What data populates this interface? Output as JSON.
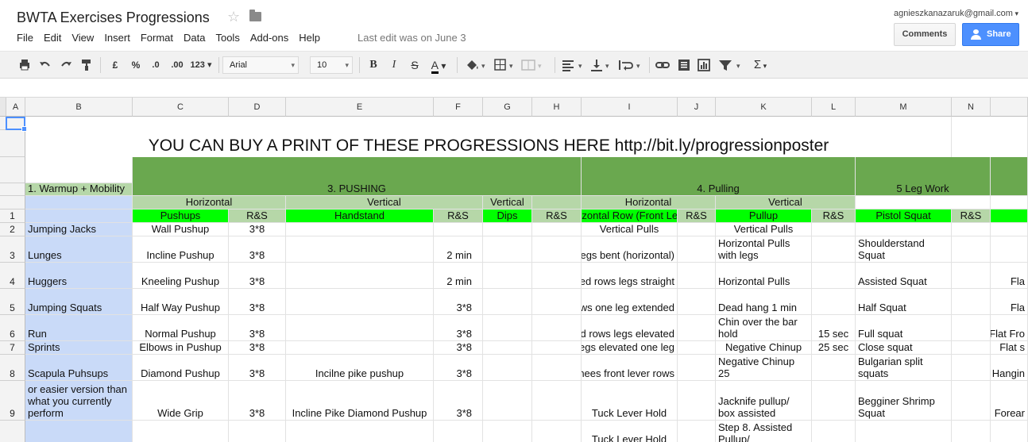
{
  "app": {
    "title": "BWTA Exercises Progressions",
    "account": "agnieszkanazaruk@gmail.com",
    "comments_label": "Comments",
    "share_label": "Share",
    "last_edit": "Last edit was on June 3",
    "menu": [
      "File",
      "Edit",
      "View",
      "Insert",
      "Format",
      "Data",
      "Tools",
      "Add-ons",
      "Help"
    ]
  },
  "toolbar": {
    "currency": "£",
    "percent": "%",
    "dec_less": ".0",
    "dec_more": ".00",
    "format_more": "123",
    "font": "Arial",
    "font_size": "10",
    "bold": "B",
    "italic": "I",
    "strike": "S",
    "text_color": "A",
    "sigma": "Σ"
  },
  "columns": [
    "A",
    "B",
    "C",
    "D",
    "E",
    "F",
    "G",
    "H",
    "I",
    "J",
    "K",
    "L",
    "M",
    "N"
  ],
  "banner": "YOU CAN BUY A PRINT OF THESE PROGRESSIONS HERE http://bit.ly/progressionposter",
  "groups": {
    "pushing": "3. PUSHING",
    "pulling": "4. Pulling",
    "legs": "5 Leg Work"
  },
  "subheaders": {
    "warmup": "1. Warmup + Mobility",
    "push_horizontal": "Horizontal",
    "push_vertical": "Vertical",
    "push_vertical2": "Vertical",
    "pull_horizontal": "Horizontal",
    "pull_vertical": "Vertical"
  },
  "header_row": {
    "num": "1",
    "c": "Pushups",
    "d": "R&S",
    "e": "Handstand",
    "f": "R&S",
    "g": "Dips",
    "h": "R&S",
    "i": "Horizontal Row (Front Lever)",
    "j": "R&S",
    "k": "Pullup",
    "l": "R&S",
    "m": "Pistol Squat",
    "n": "R&S"
  },
  "rows": [
    {
      "num": "2",
      "b": "Jumping Jacks",
      "c": "Wall Pushup",
      "d": "3*8",
      "e": "",
      "f": "",
      "i": "Vertical Pulls",
      "k": "Vertical Pulls",
      "l": "",
      "m": "",
      "o": ""
    },
    {
      "num": "3",
      "b": "Lunges",
      "c": "Incline Pushup",
      "d": "3*8",
      "e": "",
      "f": "2 min",
      "i": "Rows legs bent  (horizontal)",
      "k": "Horizontal Pulls with legs",
      "l": "",
      "m": "Shoulderstand Squat",
      "o": ""
    },
    {
      "num": "4",
      "b": "Huggers",
      "c": "Kneeling Pushup",
      "d": "3*8",
      "e": "",
      "f": "2 min",
      "i": "Inverted rows legs straight",
      "k": "Horizontal Pulls",
      "l": "",
      "m": "Assisted Squat",
      "o": "Fla"
    },
    {
      "num": "5",
      "b": "Jumping Squats",
      "c": "Half Way Pushup",
      "d": "3*8",
      "e": "",
      "f": "3*8",
      "i": "Inverted rows one leg extended",
      "k": "Dead hang 1 min",
      "l": "",
      "m": "Half Squat",
      "o": "Fla"
    },
    {
      "num": "6",
      "b": "Run",
      "c": "Normal Pushup",
      "d": "3*8",
      "e": "",
      "f": "3*8",
      "i": "Inverted rows legs elevated",
      "k": "Chin over the bar hold",
      "l": "15 sec",
      "m": "Full squat",
      "o": "Flat Fro"
    },
    {
      "num": "7",
      "b": "Sprints",
      "c": "Elbows in Pushup",
      "d": "3*8",
      "e": "",
      "f": "3*8",
      "i": "Rows legs elevated one leg",
      "k": "Negative Chinup",
      "l": "25 sec",
      "m": "Close squat",
      "o": "Flat s"
    },
    {
      "num": "8",
      "b": "Scapula Puhsups",
      "c": "Diamond Pushup",
      "d": "3*8",
      "e": "Incilne pike pushup",
      "f": "3*8",
      "i": "Tuck Knees front lever rows",
      "k": "Negative Chinup 25",
      "l": "",
      "m": "Bulgarian split squats",
      "o": "Hangin"
    },
    {
      "num": "9",
      "b": "or easier version than what you currently perform",
      "c": "Wide Grip",
      "d": "3*8",
      "e": "Incline Pike Diamond Pushup",
      "f": "3*8",
      "i": "Tuck Lever Hold",
      "k": "Jacknife pullup/ box assisted",
      "l": "",
      "m": "Begginer Shrimp Squat",
      "o": "Forear"
    },
    {
      "num": "",
      "b": "",
      "c": "",
      "d": "",
      "e": "",
      "f": "",
      "i": "Tuck Lever Hold",
      "k": "Step 8.  Assisted Pullup/",
      "l": "",
      "m": "",
      "o": ""
    }
  ]
}
